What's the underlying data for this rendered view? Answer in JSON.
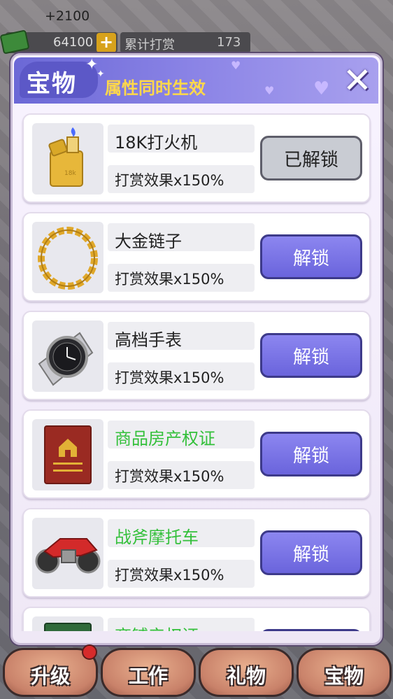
{
  "hud": {
    "gain": "+2100",
    "money": "64100",
    "plus": "+",
    "reward_label": "累计打赏",
    "reward_value": "173"
  },
  "panel": {
    "title": "宝物",
    "subtitle": "属性同时生效",
    "close": "✕"
  },
  "items": [
    {
      "name": "18K打火机",
      "effect": "打赏效果x150%",
      "button": "已解锁",
      "icon": "lighter-icon",
      "unlocked": true
    },
    {
      "name": "大金链子",
      "effect": "打赏效果x150%",
      "button": "解锁",
      "icon": "gold-chain-icon",
      "unlocked": false
    },
    {
      "name": "高档手表",
      "effect": "打赏效果x150%",
      "button": "解锁",
      "icon": "watch-icon",
      "unlocked": false
    },
    {
      "name": "商品房产权证",
      "effect": "打赏效果x150%",
      "button": "解锁",
      "icon": "property-certificate-icon",
      "unlocked": false
    },
    {
      "name": "战斧摩托车",
      "effect": "打赏效果x150%",
      "button": "解锁",
      "icon": "motorcycle-icon",
      "unlocked": false
    },
    {
      "name": "商铺产权证",
      "effect": "",
      "button": "",
      "icon": "shop-certificate-icon",
      "unlocked": false
    }
  ],
  "nav": {
    "upgrade": "升级",
    "work": "工作",
    "gift": "礼物",
    "treasure": "宝物"
  },
  "colors": {
    "accent": "#6a64dc",
    "green_name": "#34c03b",
    "gold_subtitle": "#ffd84a"
  }
}
